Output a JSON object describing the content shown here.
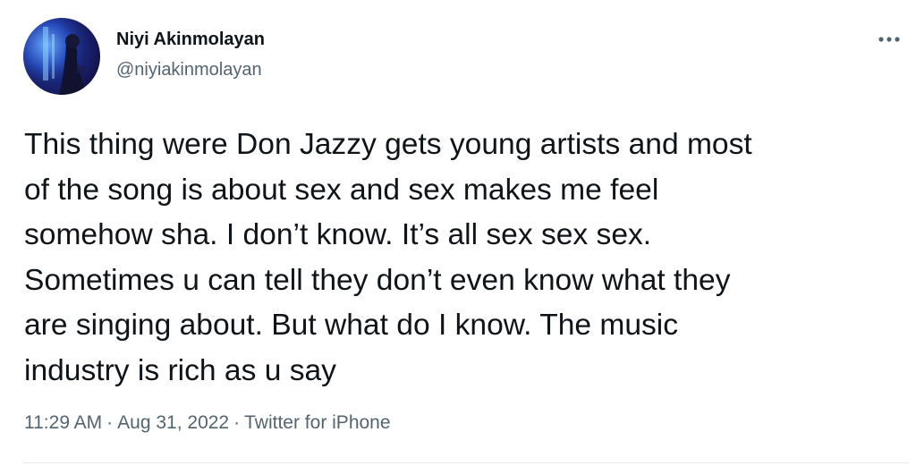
{
  "author": {
    "name": "Niyi Akinmolayan",
    "handle": "@niyiakinmolayan"
  },
  "tweet": {
    "text": "This thing were Don Jazzy gets young artists and most\nof the song is about sex and sex makes me feel\nsomehow sha. I don’t know. It’s all sex sex sex.\nSometimes u can tell they don’t even know what they\nare singing about. But what do I know. The music\nindustry is rich as u say",
    "time": "11:29 AM",
    "date": "Aug 31, 2022",
    "separator": "·",
    "source": "Twitter for iPhone"
  },
  "icons": {
    "more": "more-dots-icon",
    "avatar": "profile-photo"
  },
  "colors": {
    "text_primary": "#0f1419",
    "text_secondary": "#536471",
    "divider": "#e3e8ec"
  }
}
